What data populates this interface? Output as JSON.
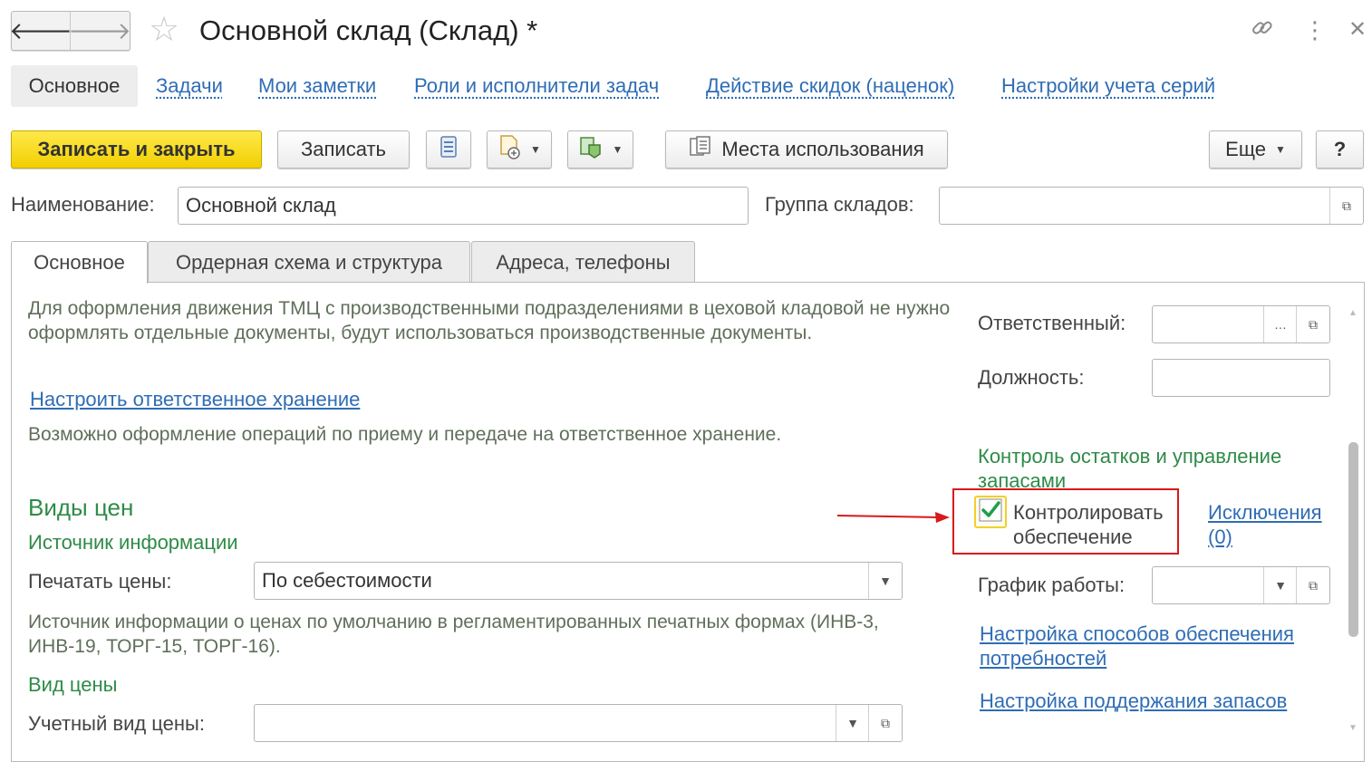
{
  "window": {
    "title": "Основной склад (Склад) *"
  },
  "section_tabs": {
    "active": "Основное",
    "links": [
      "Задачи",
      "Мои заметки",
      "Роли и исполнители задач",
      "Действие скидок (наценок)",
      "Настройки учета серий"
    ]
  },
  "toolbar": {
    "save_close": "Записать и закрыть",
    "save": "Записать",
    "usage_places": "Места использования",
    "more": "Еще",
    "help": "?"
  },
  "header_fields": {
    "name_label": "Наименование:",
    "name_value": "Основной склад",
    "group_label": "Группа складов:",
    "group_value": ""
  },
  "tabs": [
    "Основное",
    "Ордерная схема и структура",
    "Адреса, телефоны"
  ],
  "main": {
    "workshop_note": "Для оформления движения ТМЦ с производственными подразделениями в цеховой кладовой не нужно оформлять отдельные документы, будут использоваться производственные документы.",
    "custody_link": "Настроить ответственное хранение",
    "custody_note": "Возможно оформление операций по приему и передаче на ответственное хранение.",
    "price_types_heading": "Виды цен",
    "info_source_heading": "Источник информации",
    "print_prices_label": "Печатать цены:",
    "print_prices_value": "По себестоимости",
    "price_source_note": "Источник информации о ценах по умолчанию в регламентированных печатных формах (ИНВ-3, ИНВ-19, ТОРГ-15, ТОРГ-16).",
    "price_kind_heading": "Вид цены",
    "accounting_price_label": "Учетный вид цены:",
    "accounting_price_value": ""
  },
  "right": {
    "responsible_label": "Ответственный:",
    "responsible_value": "",
    "position_label": "Должность:",
    "position_value": "",
    "stock_control_heading": "Контроль остатков и управление запасами",
    "control_checkbox_label": "Контролировать обеспечение",
    "control_checked": true,
    "exceptions_link": "Исключения (0)",
    "schedule_label": "График работы:",
    "schedule_value": "",
    "supply_methods_link": "Настройка способов обеспечения потребностей",
    "stock_maintenance_link": "Настройка поддержания запасов"
  },
  "colors": {
    "accent_yellow": "#f5d400",
    "link_blue": "#2f6db5",
    "heading_green": "#2e8b47",
    "highlight_red": "#d81a1a"
  },
  "icons": {
    "back": "arrow-left-icon",
    "forward": "arrow-right-icon",
    "favorite": "star-icon",
    "link": "link-icon",
    "menu": "kebab-icon",
    "close": "close-icon"
  }
}
